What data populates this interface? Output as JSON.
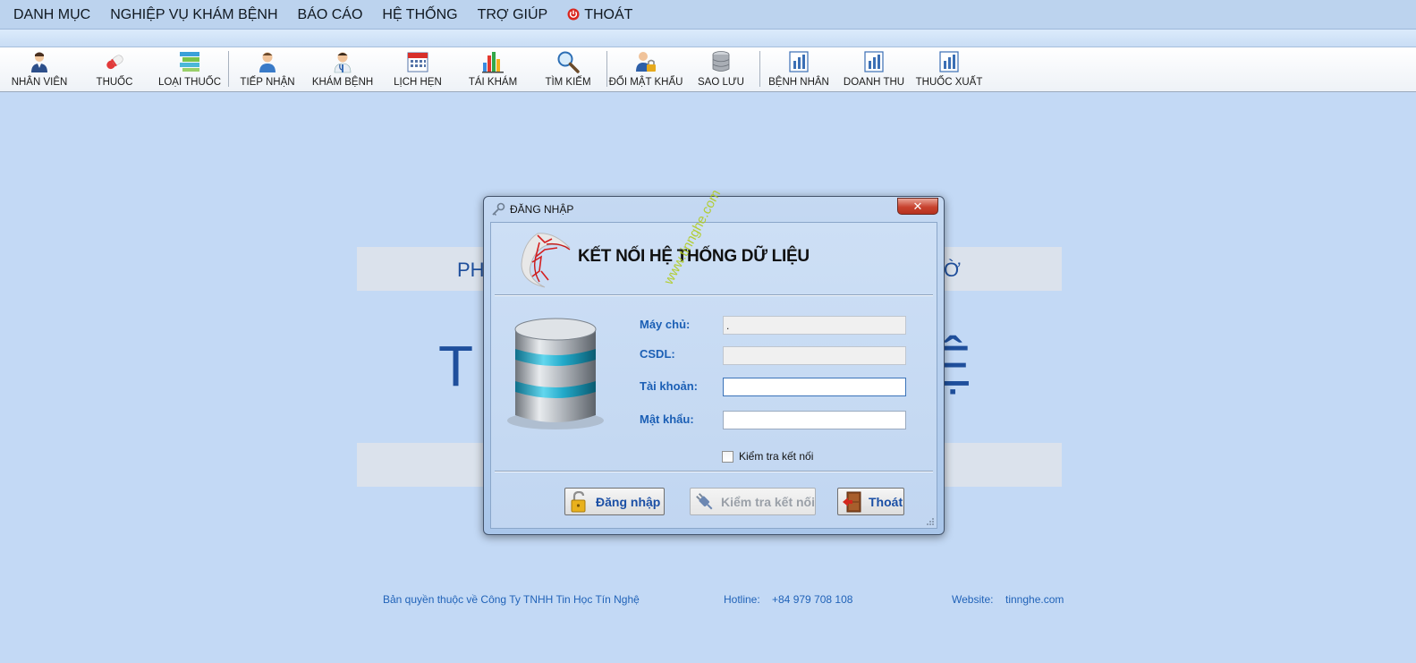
{
  "menu": {
    "items": [
      "DANH MỤC",
      "NGHIỆP VỤ KHÁM BỆNH",
      "BÁO CÁO",
      "HỆ THỐNG",
      "TRỢ GIÚP"
    ],
    "exit": "THOÁT"
  },
  "toolbar": {
    "group1": [
      "NHÂN VIÊN",
      "THUỐC",
      "LOẠI THUỐC"
    ],
    "group2": [
      "TIẾP NHẬN",
      "KHÁM BỆNH",
      "LỊCH HẸN",
      "TÁI KHÁM",
      "TÌM KIẾM"
    ],
    "group3": [
      "ĐỔI MẬT KHẨU",
      "SAO LƯU"
    ],
    "group4": [
      "BỆNH NHÂN",
      "DOANH THU",
      "THUỐC XUẤT"
    ]
  },
  "background": {
    "banner_left": "PH",
    "banner_right": "Ờ",
    "big_left": "T",
    "big_right": "Ệ"
  },
  "footer": {
    "copyright": "Bản quyền thuộc về Công Ty TNHH Tin Học Tín Nghệ",
    "hotline_label": "Hotline:",
    "hotline": "+84 979 708 108",
    "website_label": "Website:",
    "website": "tinnghe.com"
  },
  "dialog": {
    "title": "ĐĂNG NHẬP",
    "close": "✕",
    "heading": "KẾT NỐI HỆ THỐNG DỮ LIỆU",
    "watermark": "www.tinnghe.com",
    "fields": {
      "server_label": "Máy chủ:",
      "server_value": ".",
      "db_label": "CSDL:",
      "db_value": "",
      "account_label": "Tài khoản:",
      "account_value": "",
      "password_label": "Mật khẩu:",
      "password_value": ""
    },
    "check_label": "Kiểm tra kết nối",
    "buttons": {
      "login": "Đăng nhập",
      "test": "Kiểm tra kết nối",
      "exit": "Thoát"
    }
  }
}
